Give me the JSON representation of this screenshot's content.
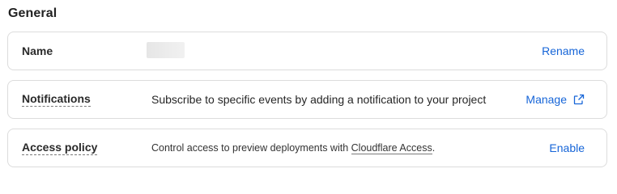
{
  "section": {
    "title": "General"
  },
  "rows": {
    "name": {
      "label": "Name",
      "action": "Rename"
    },
    "notifications": {
      "label": "Notifications",
      "description": "Subscribe to specific events by adding a notification to your project",
      "action": "Manage",
      "action_icon": "external-link-icon"
    },
    "access": {
      "label": "Access policy",
      "description_prefix": "Control access to preview deployments with ",
      "description_link": "Cloudflare Access",
      "description_suffix": ".",
      "action": "Enable"
    }
  },
  "colors": {
    "link": "#1665d8",
    "border": "#dcdcdc"
  }
}
